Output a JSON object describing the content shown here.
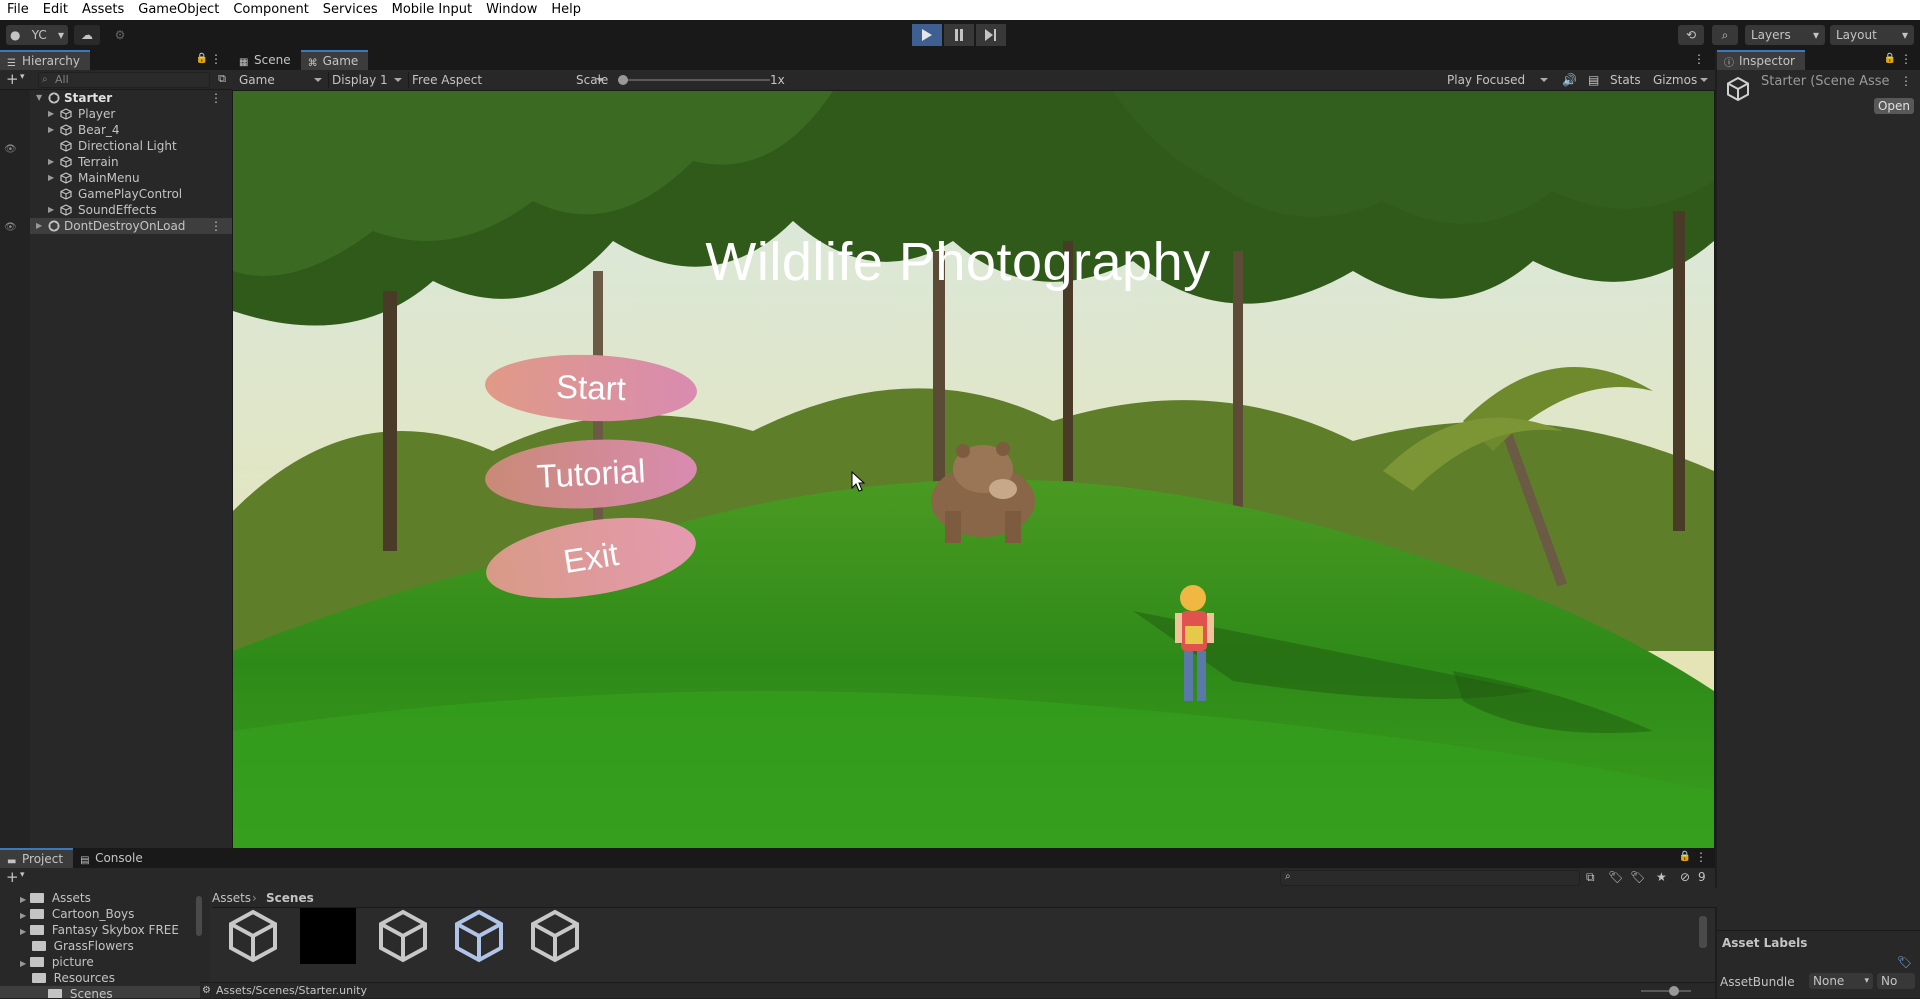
{
  "menubar": [
    "File",
    "Edit",
    "Assets",
    "GameObject",
    "Component",
    "Services",
    "Mobile Input",
    "Window",
    "Help"
  ],
  "toolbar": {
    "account": "YC",
    "layers": "Layers",
    "layout": "Layout"
  },
  "hierarchy": {
    "tab": "Hierarchy",
    "search_placeholder": "All",
    "scene": "Starter",
    "children": [
      "Player",
      "Bear_4",
      "Directional Light",
      "Terrain",
      "MainMenu",
      "GamePlayControl",
      "SoundEffects"
    ],
    "dont_destroy": "DontDestroyOnLoad"
  },
  "scene_tabs": {
    "scene": "Scene",
    "game": "Game"
  },
  "game_controls": {
    "mode": "Game",
    "display": "Display 1",
    "aspect": "Free Aspect",
    "scale_label": "Scale",
    "scale_value": "1x",
    "play_mode": "Play Focused",
    "stats": "Stats",
    "gizmos": "Gizmos"
  },
  "game": {
    "title": "Wildlife Photography",
    "buttons": {
      "start": "Start",
      "tutorial": "Tutorial",
      "exit": "Exit"
    },
    "button_color": "#d6928a"
  },
  "inspector": {
    "tab": "Inspector",
    "object": "Starter (Scene Asse",
    "open": "Open",
    "asset_labels": "Asset Labels",
    "asset_bundle_label": "AssetBundle",
    "asset_bundle_value": "None",
    "asset_bundle_variant": "No"
  },
  "project": {
    "tabs": [
      "Project",
      "Console"
    ],
    "breadcrumb": [
      "Assets",
      "Scenes"
    ],
    "tree": [
      "Assets",
      "Cartoon_Boys",
      "Fantasy Skybox FREE",
      "GrassFlowers",
      "picture",
      "Resources",
      "Scenes"
    ],
    "status_path": "Assets/Scenes/Starter.unity",
    "hidden_count": "9"
  },
  "colors": {
    "accent": "#3a79bb",
    "play_active": "#3d5f91",
    "panel": "#282828"
  }
}
